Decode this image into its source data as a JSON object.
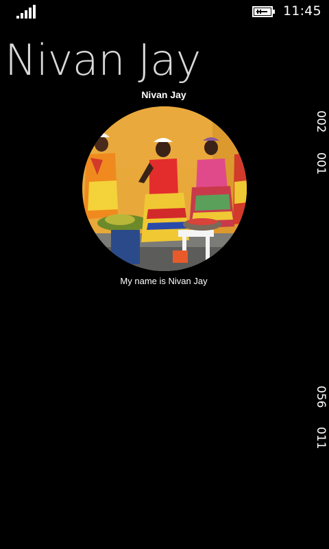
{
  "status_bar": {
    "time": "11:45",
    "signal_icon": "signal-strength-icon",
    "battery_icon": "battery-charging-icon"
  },
  "page": {
    "title": "Nivan Jay"
  },
  "profile": {
    "name": "Nivan Jay",
    "caption": "My name is Nivan Jay",
    "photo_icon": "profile-photo"
  },
  "side_labels": [
    "002",
    "001",
    "056",
    "011"
  ]
}
